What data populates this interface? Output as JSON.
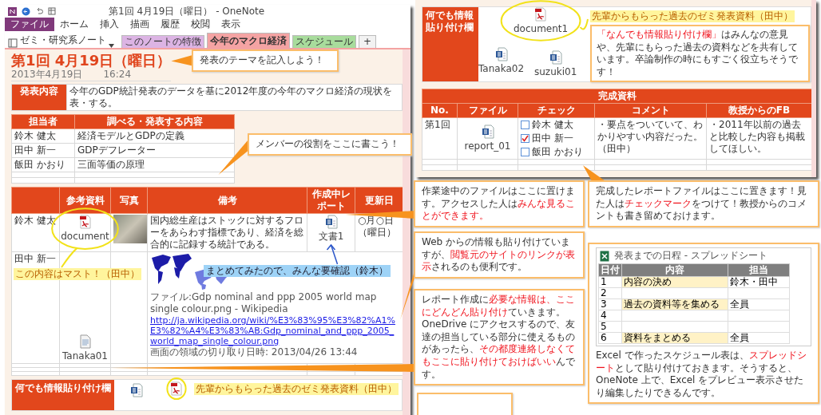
{
  "left_window": {
    "title": "第1回 4月19日（曜日） - OneNote",
    "menu": [
      {
        "label": "ファイル",
        "kind": "file"
      },
      {
        "label": "ホーム",
        "kind": "tab"
      },
      {
        "label": "挿入",
        "kind": "tab"
      },
      {
        "label": "描画",
        "kind": "tab"
      },
      {
        "label": "履歴",
        "kind": "tab"
      },
      {
        "label": "校閲",
        "kind": "tab"
      },
      {
        "label": "表示",
        "kind": "tab"
      }
    ],
    "notebook": "ゼミ・研究系ノート",
    "sections": [
      {
        "label": "このノートの特徴",
        "color": "#dcb4e4",
        "selected": false
      },
      {
        "label": "今年のマクロ経済",
        "color": "#f4a3a3",
        "selected": true
      },
      {
        "label": "スケジュール",
        "color": "#a8dc9c",
        "selected": false
      }
    ],
    "add_section": "+",
    "page": {
      "title": "第1回 4月19日（曜日）",
      "date": "2013年4月19日",
      "time": "16:24",
      "theme": {
        "label": "発表内容",
        "text": "今年のGDP統計発表のデータを基に2012年度の今年のマクロ経済の現状を表・する。"
      },
      "roles": {
        "columns": [
          "担当者",
          "調べる・発表する内容"
        ],
        "rows": [
          [
            "鈴木 健太",
            "経済モデルとGDPの定義"
          ],
          [
            "田中 新一",
            "GDPデフレーター"
          ],
          [
            "飯田 かおり",
            "三面等価の原理"
          ]
        ]
      },
      "materials": {
        "columns": [
          "参考資料",
          "写真",
          "備考",
          "作成中レポート",
          "更新日"
        ],
        "rows": [
          {
            "member": "鈴木 健太",
            "reference": {
              "kind": "pdf",
              "name": "document",
              "circled": true
            },
            "photo": true,
            "note": "国内総生産はストックに対するフローをあらわす指標であり、経済を総合的に記録する統計である。",
            "report": {
              "kind": "word",
              "name": "文書1"
            },
            "updated": "○月○日（曜日）"
          },
          {
            "member": "田中 新一",
            "reference": {
              "kind": "file",
              "name": "Tanaka01",
              "circled": false
            },
            "sticky": "この内容はマスト！（田中）",
            "clip": {
              "map": true,
              "title": "ファイル:Gdp nominal and ppp 2005 world map single colour.png - Wikipedia",
              "link": "http://ja.wikipedia.org/wiki/%E3%83%95%E3%82%A1%E3%82%A4%E3%83%AB:Gdp_nominal_and_ppp_2005_world_map_single_colour.png",
              "time": "画面の領域の切り取り日時: 2013/04/26 13:44",
              "comment": "まとめてみたので、みんな要確認（鈴木）"
            }
          }
        ]
      }
    },
    "paste_panel": {
      "label": "何でも情報貼り付け欄",
      "files": [
        {
          "kind": "word",
          "circled": false
        },
        {
          "kind": "pdf",
          "circled": true
        }
      ],
      "note": "先輩からもらった過去のゼミ発表資料（田中）"
    }
  },
  "right_window": {
    "paste_panel": {
      "label": "何でも情報貼り付け欄",
      "files": [
        {
          "kind": "word",
          "name": "Tanaka02",
          "circled": false
        },
        {
          "kind": "pdf",
          "name": "document1",
          "circled": true
        },
        {
          "kind": "word",
          "name": "suzuki01",
          "circled": false
        }
      ],
      "note": "先輩からもらった過去のゼミ発表資料（田中）"
    },
    "finished": {
      "title": "完成資料",
      "columns": [
        "No.",
        "ファイル",
        "チェック",
        "コメント",
        "教授からのFB"
      ],
      "rows": [
        {
          "no": "第1回",
          "file": {
            "kind": "word",
            "name": "report_01"
          },
          "checks": [
            {
              "label": "鈴木 健太",
              "checked": false
            },
            {
              "label": "田中 新一",
              "checked": true
            },
            {
              "label": "飯田 かおり",
              "checked": false
            }
          ],
          "comment": "・要点をついていて、わかりやすい内容だった。（田中）",
          "feedback": "・2011年以前の過去と比較した内容も掲載してほしい。"
        }
      ]
    }
  },
  "callouts": [
    {
      "kind": "text",
      "segments": [
        {
          "text": "発表のテーマを記入しよう！",
          "emphasis": false
        }
      ]
    },
    {
      "kind": "text",
      "segments": [
        {
          "text": "「なんでも情報貼り付け欄」",
          "emphasis": true
        },
        {
          "text": "はみんなの意見や、先輩にもらった過去の資料などを共有しています。卒論制作の時にもすごく役立ちそうです！",
          "emphasis": false
        }
      ]
    },
    {
      "kind": "text",
      "segments": [
        {
          "text": "メンバーの役割をここに書こう！",
          "emphasis": false
        }
      ]
    },
    {
      "kind": "text",
      "segments": [
        {
          "text": "作業途中のファイルはここに置けます。アクセスした人は",
          "emphasis": false
        },
        {
          "text": "みんな見ることができます。",
          "emphasis": true
        }
      ]
    },
    {
      "kind": "text",
      "segments": [
        {
          "text": "完成したレポートファイルはここに置きます！見た人は",
          "emphasis": false
        },
        {
          "text": "チェックマーク",
          "emphasis": true
        },
        {
          "text": "をつけて！教授からのコメントも書き留めておけます。",
          "emphasis": false
        }
      ]
    },
    {
      "kind": "text",
      "segments": [
        {
          "text": "Web からの情報も貼り付けていますが、",
          "emphasis": false
        },
        {
          "text": "閲覧元のサイトのリンクが表示",
          "emphasis": true
        },
        {
          "text": "されるのも便利です。",
          "emphasis": false
        }
      ]
    },
    {
      "kind": "sheet",
      "sheet": {
        "title": "発表までの日程 - スプレッドシート",
        "columns": [
          "日付",
          "内容",
          "担当"
        ],
        "rows": [
          [
            "1",
            "内容の決め",
            "鈴木・田中"
          ],
          [
            "2"
          ],
          [
            "3",
            "過去の資料等を集める",
            "全員"
          ],
          [
            "4"
          ],
          [
            "5"
          ],
          [
            "6",
            "資料をまとめる",
            "全員"
          ]
        ]
      },
      "segments": [
        {
          "text": "Excel で作ったスケジュール表は、",
          "emphasis": false
        },
        {
          "text": "スプレッドシート",
          "emphasis": true
        },
        {
          "text": "として貼り付けておきます。そうすると、OneNote 上で、Excel をプレビュー表示させたり編集したりできるんです。",
          "emphasis": false
        }
      ]
    },
    {
      "kind": "text",
      "segments": [
        {
          "text": "レポート作成に",
          "emphasis": false
        },
        {
          "text": "必要な情報は、ここにどんどん貼り付け",
          "emphasis": true
        },
        {
          "text": "ていきます。\nOneDrive にアクセスするので、友達の担当している部分に使えるものがあったら、",
          "emphasis": false
        },
        {
          "text": "その都度連絡しなくてもここに貼り付けておけばいい",
          "emphasis": true
        },
        {
          "text": "んです。",
          "emphasis": false
        }
      ]
    },
    {
      "kind": "empty"
    }
  ]
}
